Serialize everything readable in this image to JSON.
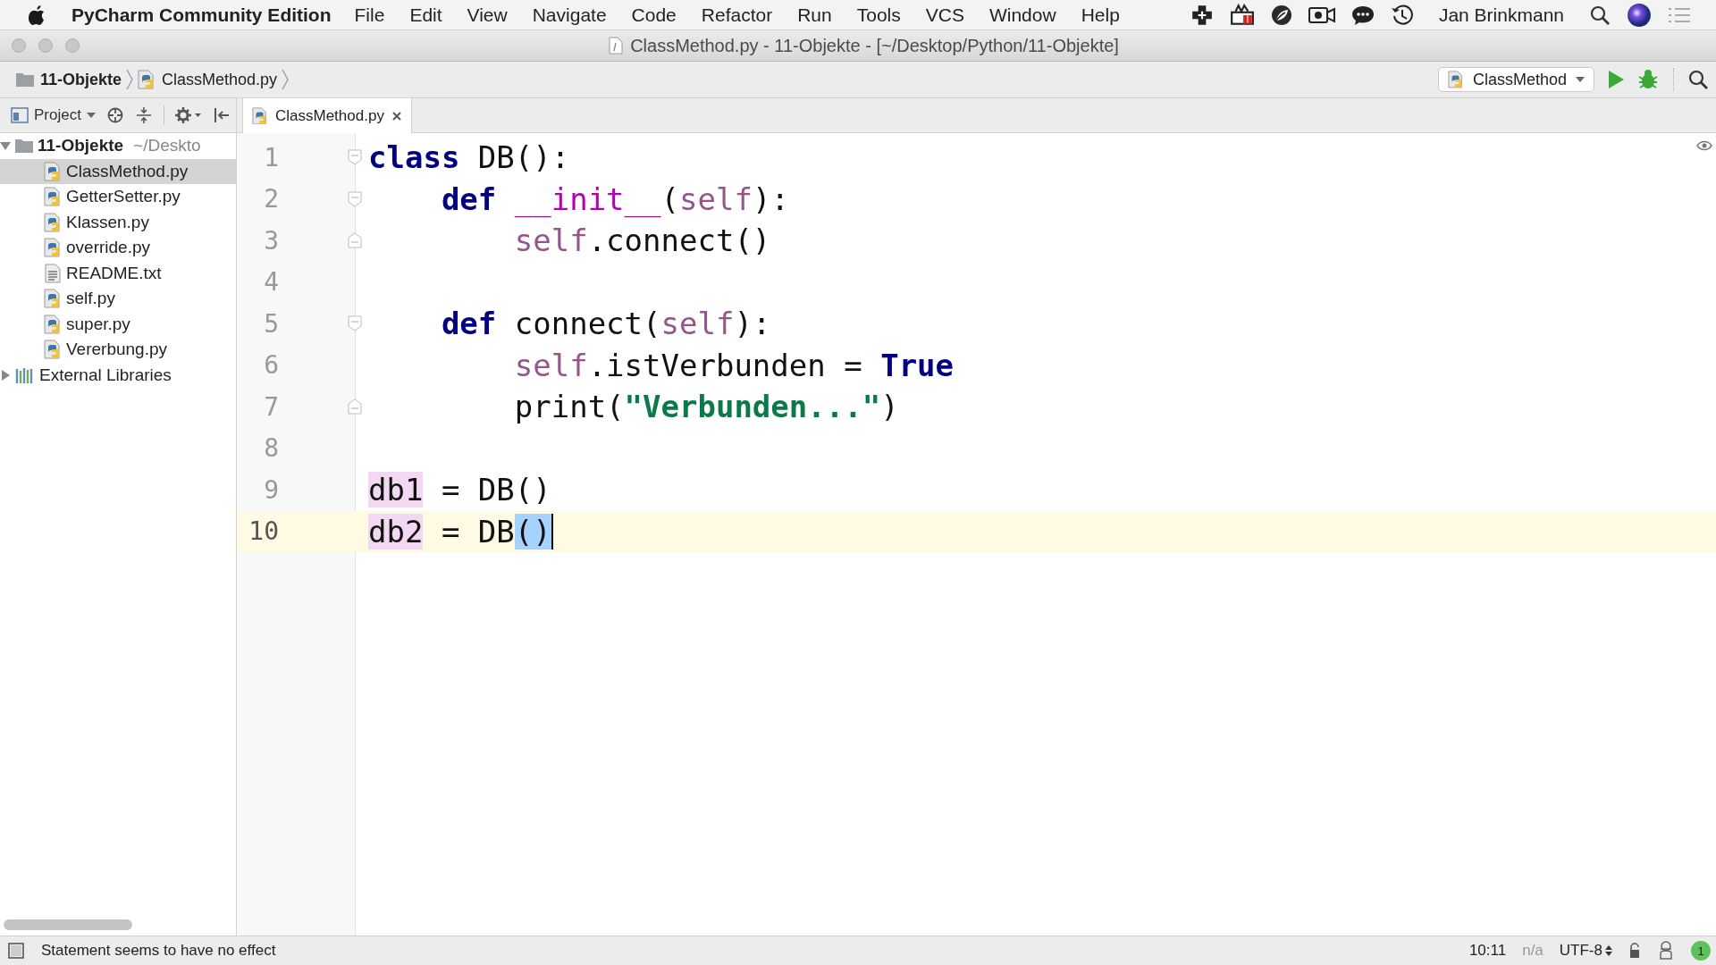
{
  "menu_bar": {
    "app_name": "PyCharm Community Edition",
    "menus": [
      "File",
      "Edit",
      "View",
      "Navigate",
      "Code",
      "Refactor",
      "Run",
      "Tools",
      "VCS",
      "Window",
      "Help"
    ],
    "user": "Jan Brinkmann"
  },
  "window": {
    "title": "ClassMethod.py - 11-Objekte - [~/Desktop/Python/11-Objekte]"
  },
  "breadcrumbs": [
    {
      "kind": "folder",
      "label": "11-Objekte"
    },
    {
      "kind": "python-file",
      "label": "ClassMethod.py"
    }
  ],
  "run_config": {
    "label": "ClassMethod"
  },
  "project_panel": {
    "label": "Project"
  },
  "tabs": [
    {
      "label": "ClassMethod.py",
      "selected": true
    }
  ],
  "tree": [
    {
      "kind": "folder",
      "label": "11-Objekte",
      "path": "~/Deskto",
      "expanded": true,
      "selected": false,
      "children": [
        {
          "kind": "python-file",
          "label": "ClassMethod.py",
          "selected": true
        },
        {
          "kind": "python-file",
          "label": "GetterSetter.py",
          "selected": false
        },
        {
          "kind": "python-file",
          "label": "Klassen.py",
          "selected": false
        },
        {
          "kind": "python-file",
          "label": "override.py",
          "selected": false
        },
        {
          "kind": "text-file",
          "label": "README.txt",
          "selected": false
        },
        {
          "kind": "python-file",
          "label": "self.py",
          "selected": false
        },
        {
          "kind": "python-file",
          "label": "super.py",
          "selected": false
        },
        {
          "kind": "python-file",
          "label": "Vererbung.py",
          "selected": false
        }
      ]
    },
    {
      "kind": "library",
      "label": "External Libraries",
      "expanded": false,
      "selected": false
    }
  ],
  "editor": {
    "lines": [
      {
        "number": "1",
        "current": false,
        "fold": {
          "kind": "start"
        },
        "tokens": [
          {
            "kind": "keyword",
            "text": "class"
          },
          {
            "kind": "plain",
            "text": " DB():"
          }
        ],
        "children": [
          {
            "number": "2",
            "current": false,
            "fold": {
              "kind": "start"
            },
            "tokens": [
              {
                "kind": "keyword",
                "text": "def "
              },
              {
                "kind": "dunder",
                "text": "__init__"
              },
              {
                "kind": "plain",
                "text": "("
              },
              {
                "kind": "self",
                "text": "self"
              },
              {
                "kind": "plain",
                "text": "):"
              }
            ],
            "children": [
              {
                "number": "3",
                "current": false,
                "fold": {
                  "kind": "end"
                },
                "tokens": [
                  {
                    "kind": "self",
                    "text": "self"
                  },
                  {
                    "kind": "plain",
                    "text": ".connect()"
                  }
                ]
              }
            ]
          },
          {
            "number": "4",
            "current": false
          },
          {
            "number": "5",
            "current": false,
            "fold": {
              "kind": "start"
            },
            "tokens": [
              {
                "kind": "keyword",
                "text": "def"
              },
              {
                "kind": "plain",
                "text": " connect("
              },
              {
                "kind": "self",
                "text": "self"
              },
              {
                "kind": "plain",
                "text": "):"
              }
            ],
            "children": [
              {
                "number": "6",
                "current": false,
                "tokens": [
                  {
                    "kind": "self",
                    "text": "self"
                  },
                  {
                    "kind": "plain",
                    "text": ".istVerbunden = "
                  },
                  {
                    "kind": "keyword",
                    "text": "True"
                  }
                ]
              },
              {
                "number": "7",
                "current": false,
                "fold": {
                  "kind": "end"
                },
                "tokens": [
                  {
                    "kind": "plain",
                    "text": "print("
                  },
                  {
                    "kind": "string",
                    "text": "\"Verbunden...\""
                  },
                  {
                    "kind": "plain",
                    "text": ")"
                  }
                ]
              }
            ]
          }
        ]
      },
      {
        "number": "8",
        "current": false
      },
      {
        "number": "9",
        "current": false,
        "tokens": [
          {
            "kind": "usage",
            "text": "db1"
          },
          {
            "kind": "plain",
            "text": " = DB()"
          }
        ]
      },
      {
        "number": "10",
        "current": true,
        "tokens": [
          {
            "kind": "usage",
            "text": "db2"
          },
          {
            "kind": "plain",
            "text": " = DB"
          },
          {
            "kind": "selection",
            "text": "()"
          }
        ]
      }
    ]
  },
  "status_bar": {
    "message": "Statement seems to have no effect",
    "position": "10:11",
    "line_separator": "n/a",
    "encoding": "UTF-8",
    "notifications": "1"
  }
}
